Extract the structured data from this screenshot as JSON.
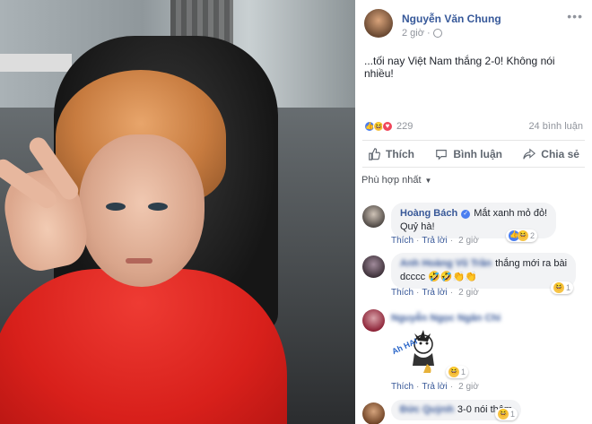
{
  "post": {
    "author": "Nguyễn Văn Chung",
    "time": "2 giờ",
    "text": "...tối nay Việt Nam thắng 2-0! Không nói nhiều!",
    "reaction_count": "229",
    "comment_count": "24 bình luận",
    "actions": {
      "like": "Thích",
      "comment": "Bình luận",
      "share": "Chia sẻ"
    },
    "sort_label": "Phù hợp nhất"
  },
  "comments": [
    {
      "name": "Hoàng Bách",
      "verified": true,
      "text_line1": "Mắt xanh mỏ đỏ!",
      "text_line2": "Quỷ hà!",
      "like": "Thích",
      "reply": "Trả lời",
      "time": "2 giờ",
      "reactions": "2"
    },
    {
      "name": "Anh Hoàng Vũ Trần",
      "blurred": true,
      "text_line1": "thắng mới ra bài",
      "text_line2": "dcccc 🤣🤣👏👏",
      "like": "Thích",
      "reply": "Trả lời",
      "time": "2 giờ",
      "reactions": "1"
    },
    {
      "name": "Nguyễn Ngọc Ngân Chi",
      "blurred": true,
      "sticker": "Ah HAI",
      "like": "Thích",
      "reply": "Trả lời",
      "time": "2 giờ",
      "reactions": "1"
    },
    {
      "name": "Đức Quỳnh",
      "blurred": true,
      "text_line1": "3-0 nói thêm",
      "reactions": "1"
    }
  ],
  "colors": {
    "link": "#385898",
    "muted": "#90949c",
    "like": "#4a7ef0",
    "love": "#f0465a",
    "haha": "#f7c445"
  },
  "icons": [
    "more-icon",
    "globe-icon",
    "like-icon",
    "comment-icon",
    "share-icon",
    "verified-icon",
    "caret-down-icon"
  ]
}
